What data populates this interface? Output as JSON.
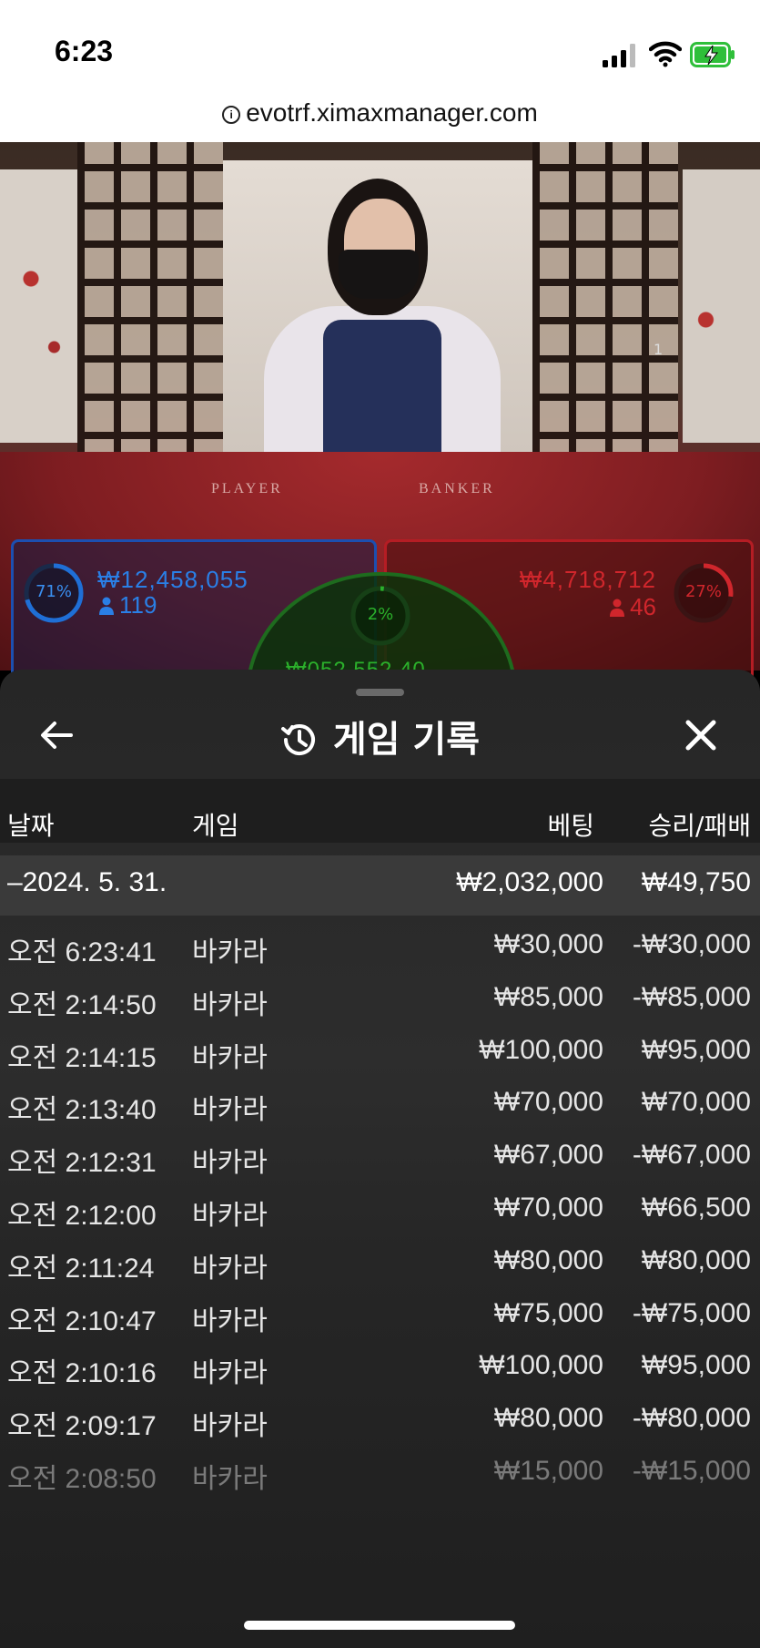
{
  "status_bar": {
    "time": "6:23"
  },
  "browser": {
    "url": "evotrf.ximaxmanager.com"
  },
  "stream": {
    "table_labels": [
      "PLAYER",
      "BANKER"
    ],
    "camera_number": "1",
    "player": {
      "percent": "71%",
      "percent_value": 0.71,
      "amount": "₩12,458,055",
      "players": "119",
      "color": "#1f6fd6"
    },
    "banker": {
      "percent": "27%",
      "percent_value": 0.27,
      "amount": "₩4,718,712",
      "players": "46",
      "color": "#d0262c"
    },
    "tie": {
      "percent": "2%",
      "percent_value": 0.02,
      "amount_partial": "₩052,552.40",
      "color": "#2bb02b"
    }
  },
  "sheet": {
    "title": "게임 기록",
    "columns": {
      "date": "날짜",
      "game": "게임",
      "bet": "베팅",
      "result": "승리/패배"
    },
    "summary": {
      "date": "–2024. 5. 31.",
      "bet": "₩2,032,000",
      "result": "₩49,750"
    },
    "rows": [
      {
        "time": "오전 6:23:41",
        "game": "바카라",
        "bet": "₩30,000",
        "result": "-₩30,000"
      },
      {
        "time": "오전 2:14:50",
        "game": "바카라",
        "bet": "₩85,000",
        "result": "-₩85,000"
      },
      {
        "time": "오전 2:14:15",
        "game": "바카라",
        "bet": "₩100,000",
        "result": "₩95,000"
      },
      {
        "time": "오전 2:13:40",
        "game": "바카라",
        "bet": "₩70,000",
        "result": "₩70,000"
      },
      {
        "time": "오전 2:12:31",
        "game": "바카라",
        "bet": "₩67,000",
        "result": "-₩67,000"
      },
      {
        "time": "오전 2:12:00",
        "game": "바카라",
        "bet": "₩70,000",
        "result": "₩66,500"
      },
      {
        "time": "오전 2:11:24",
        "game": "바카라",
        "bet": "₩80,000",
        "result": "₩80,000"
      },
      {
        "time": "오전 2:10:47",
        "game": "바카라",
        "bet": "₩75,000",
        "result": "-₩75,000"
      },
      {
        "time": "오전 2:10:16",
        "game": "바카라",
        "bet": "₩100,000",
        "result": "₩95,000"
      },
      {
        "time": "오전 2:09:17",
        "game": "바카라",
        "bet": "₩80,000",
        "result": "-₩80,000"
      },
      {
        "time": "오전 2:08:50",
        "game": "바카라",
        "bet": "₩15,000",
        "result": "-₩15,000"
      }
    ]
  }
}
